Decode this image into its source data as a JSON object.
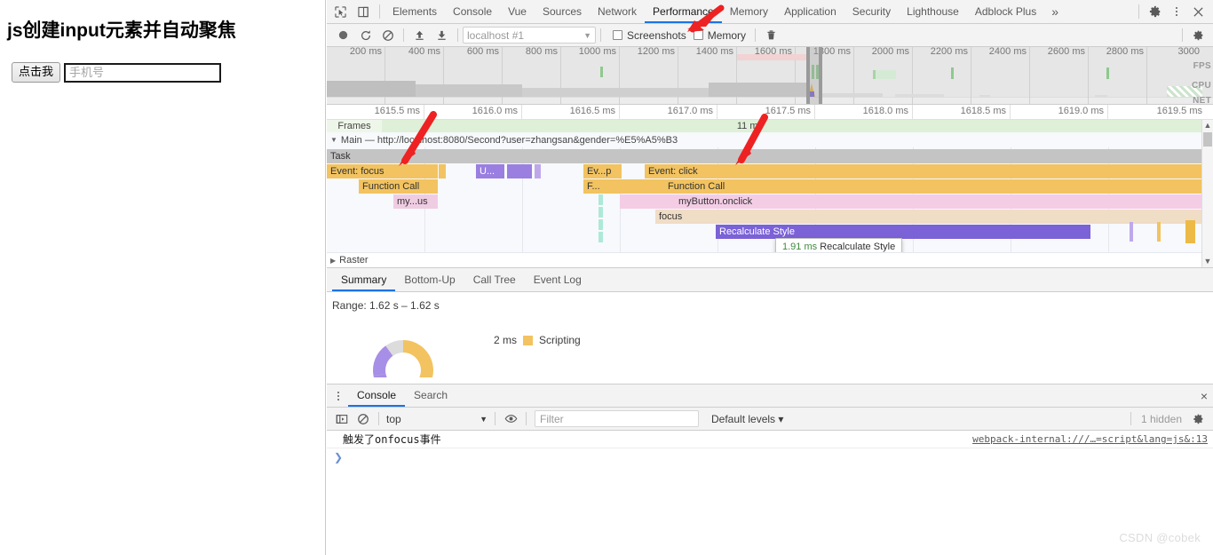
{
  "page": {
    "title": "js创建input元素并自动聚焦",
    "button_label": "点击我",
    "input_value": "",
    "input_placeholder": "手机号"
  },
  "devtools": {
    "tabs": [
      {
        "label": "Elements",
        "active": false
      },
      {
        "label": "Console",
        "active": false
      },
      {
        "label": "Vue",
        "active": false
      },
      {
        "label": "Sources",
        "active": false
      },
      {
        "label": "Network",
        "active": false
      },
      {
        "label": "Performance",
        "active": true
      },
      {
        "label": "Memory",
        "active": false
      },
      {
        "label": "Application",
        "active": false
      },
      {
        "label": "Security",
        "active": false
      },
      {
        "label": "Lighthouse",
        "active": false
      },
      {
        "label": "Adblock Plus",
        "active": false
      }
    ],
    "more_label": "»",
    "icons": {
      "inspect": "inspect-element-icon",
      "device": "device-toolbar-icon",
      "settings": "gear-icon",
      "kebab": "more-options-icon",
      "close": "close-icon"
    }
  },
  "perf_toolbar": {
    "record_label": "record-icon",
    "reload_label": "reload-record-icon",
    "clear_label": "clear-icon",
    "load_label": "load-profile-icon",
    "save_label": "save-profile-icon",
    "profile_select": "localhost #1",
    "screenshots_label": "Screenshots",
    "screenshots_checked": false,
    "memory_label": "Memory",
    "memory_checked": false,
    "trash_label": "collect-garbage-icon",
    "settings_label": "capture-settings-icon"
  },
  "overview": {
    "ticks": [
      "200 ms",
      "400 ms",
      "600 ms",
      "800 ms",
      "1000 ms",
      "1200 ms",
      "1400 ms",
      "1600 ms",
      "1800 ms",
      "2000 ms",
      "2200 ms",
      "2400 ms",
      "2600 ms",
      "2800 ms",
      "3000"
    ],
    "lanes": [
      "FPS",
      "CPU",
      "NET"
    ]
  },
  "detail_ruler": {
    "ticks": [
      "1615.5 ms",
      "1616.0 ms",
      "1616.5 ms",
      "1617.0 ms",
      "1617.5 ms",
      "1618.0 ms",
      "1618.5 ms",
      "1619.0 ms",
      "1619.5 ms"
    ]
  },
  "flame": {
    "frames_label": "Frames",
    "frames_duration": "11 ms",
    "main_track": "Main — http://localhost:8080/Second?user=zhangsan&gender=%E5%A5%B3",
    "raster_track": "Raster",
    "bars": [
      {
        "label": "Task",
        "row": 0,
        "color": "#c4c4c4"
      },
      {
        "label": "Event: focus",
        "row": 1,
        "color": "#f2c360"
      },
      {
        "label": "Function Call",
        "row": 2,
        "color": "#f2c360"
      },
      {
        "label": "my...us",
        "row": 3,
        "color": "#f0cce3"
      },
      {
        "label": "U...",
        "row": 1,
        "color": "#9a7fe0"
      },
      {
        "label": "",
        "row": 1,
        "color": "#9a7fe0"
      },
      {
        "label": "Ev...p",
        "row": 1,
        "color": "#f2c360"
      },
      {
        "label": "F...",
        "row": 2,
        "color": "#f2c360"
      },
      {
        "label": "Event: click",
        "row": 1,
        "color": "#f2c360"
      },
      {
        "label": "Function Call",
        "row": 2,
        "color": "#f2c360"
      },
      {
        "label": "myButton.onclick",
        "row": 3,
        "color": "#f4cde5"
      },
      {
        "label": "focus",
        "row": 4,
        "color": "#f0ddc6"
      },
      {
        "label": "Recalculate Style",
        "row": 5,
        "color": "#7b62d6"
      }
    ],
    "tooltip": {
      "time": "1.91 ms",
      "name": "Recalculate Style"
    }
  },
  "summary": {
    "tabs": [
      {
        "label": "Summary",
        "active": true
      },
      {
        "label": "Bottom-Up",
        "active": false
      },
      {
        "label": "Call Tree",
        "active": false
      },
      {
        "label": "Event Log",
        "active": false
      }
    ],
    "range_label": "Range: 1.62 s – 1.62 s",
    "legend": [
      {
        "value": "2 ms",
        "label": "Scripting",
        "color": "#f2c360"
      }
    ]
  },
  "drawer": {
    "tabs": [
      {
        "label": "Console",
        "active": true
      },
      {
        "label": "Search",
        "active": false
      }
    ],
    "close_label": "×"
  },
  "console": {
    "sidebar_icon": "console-sidebar-icon",
    "clear_icon": "clear-console-icon",
    "context": "top",
    "eye_icon": "live-expression-icon",
    "filter_placeholder": "Filter",
    "filter_value": "",
    "levels": "Default levels ▾",
    "hidden_count": "1 hidden",
    "settings_icon": "gear-icon",
    "messages": [
      {
        "text": "触发了onfocus事件",
        "source": "webpack-internal:///…=script&lang=js&:13"
      }
    ],
    "prompt": "❯"
  },
  "watermark": "CSDN @cobek",
  "colors": {
    "accent": "#1a73e8",
    "scripting": "#f2c360",
    "rendering": "#9a7fe0",
    "toolbar_bg": "#f3f3f3",
    "flame_bg": "#f7f9fc",
    "arrow": "#ee2222"
  }
}
